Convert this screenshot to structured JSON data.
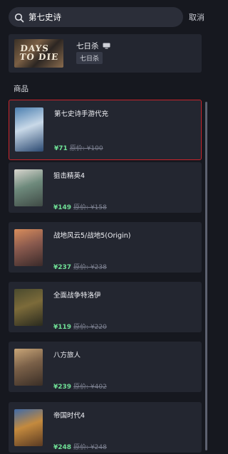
{
  "search": {
    "value": "第七史诗",
    "cancel_label": "取消"
  },
  "game_card": {
    "title": "七日杀",
    "tag": "七日杀",
    "cover_text": "DAYS TO DIE",
    "platform_icon": "monitor-icon"
  },
  "section": {
    "title": "商品"
  },
  "products": [
    {
      "name": "第七史诗手游代充",
      "price": "¥71",
      "original": "原价: ¥100",
      "highlighted": true,
      "cover_colors": [
        "#4b7fb0",
        "#c9d9e8",
        "#2c4a72"
      ]
    },
    {
      "name": "狙击精英4",
      "price": "¥149",
      "original": "原价: ¥158",
      "highlighted": false,
      "cover_colors": [
        "#d9d6cf",
        "#6e8a7c",
        "#3f4a45"
      ]
    },
    {
      "name": "战地风云5/战地5(Origin)",
      "price": "¥237",
      "original": "原价: ¥238",
      "highlighted": false,
      "cover_colors": [
        "#d98d5c",
        "#8a5a4e",
        "#3a2a2a"
      ]
    },
    {
      "name": "全面战争特洛伊",
      "price": "¥119",
      "original": "原价: ¥220",
      "highlighted": false,
      "cover_colors": [
        "#4a4a2e",
        "#7c6b3a",
        "#2a2a1e"
      ]
    },
    {
      "name": "八方旅人",
      "price": "¥239",
      "original": "原价: ¥402",
      "highlighted": false,
      "cover_colors": [
        "#c9a678",
        "#7a6048",
        "#3a2e26"
      ]
    },
    {
      "name": "帝国时代4",
      "price": "¥248",
      "original": "原价: ¥248",
      "highlighted": false,
      "cover_colors": [
        "#3f6aa8",
        "#c48a3e",
        "#5a3a22"
      ]
    }
  ]
}
